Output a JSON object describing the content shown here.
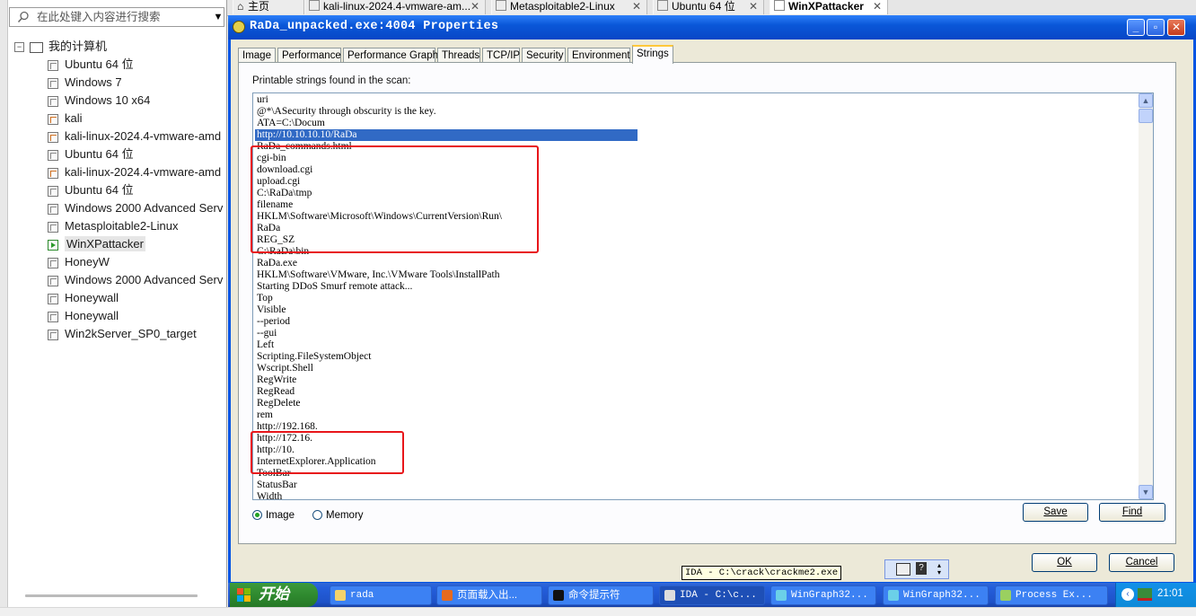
{
  "sidebar": {
    "search_placeholder": "在此处键入内容进行搜索",
    "root_label": "我的计算机",
    "items": [
      {
        "label": "Ubuntu 64 位",
        "icon": "vm-icon"
      },
      {
        "label": "Windows 7",
        "icon": "vm-icon"
      },
      {
        "label": "Windows 10 x64",
        "icon": "vm-icon"
      },
      {
        "label": "kali",
        "icon": "kali-vm-icon"
      },
      {
        "label": "kali-linux-2024.4-vmware-amd",
        "icon": "kali-vm-icon"
      },
      {
        "label": "Ubuntu 64 位",
        "icon": "vm-icon"
      },
      {
        "label": "kali-linux-2024.4-vmware-amd",
        "icon": "kali-vm-icon"
      },
      {
        "label": "Ubuntu 64 位",
        "icon": "vm-icon"
      },
      {
        "label": "Windows 2000 Advanced Serv",
        "icon": "vm-icon"
      },
      {
        "label": "Metasploitable2-Linux",
        "icon": "vm-icon"
      },
      {
        "label": "WinXPattacker",
        "icon": "running-vm-icon",
        "selected": true
      },
      {
        "label": "HoneyW",
        "icon": "vm-icon"
      },
      {
        "label": "Windows 2000 Advanced Serv",
        "icon": "vm-icon"
      },
      {
        "label": "Honeywall",
        "icon": "vm-icon"
      },
      {
        "label": "Honeywall",
        "icon": "vm-icon"
      },
      {
        "label": "Win2kServer_SP0_target",
        "icon": "vm-icon"
      }
    ]
  },
  "tabs": [
    {
      "label": "主页",
      "icon": "home-icon"
    },
    {
      "label": "kali-linux-2024.4-vmware-am...",
      "close": "✕"
    },
    {
      "label": "Metasploitable2-Linux",
      "close": "✕"
    },
    {
      "label": "Ubuntu 64 位",
      "close": "✕"
    },
    {
      "label": "WinXPattacker",
      "close": "✕",
      "active": true
    }
  ],
  "window": {
    "title": "RaDa_unpacked.exe:4004 Properties",
    "prop_tabs": [
      "Image",
      "Performance",
      "Performance Graph",
      "Threads",
      "TCP/IP",
      "Security",
      "Environment",
      "Strings"
    ],
    "active_tab": "Strings",
    "strings_label": "Printable strings found in the scan:",
    "strings": [
      "uri",
      "@*\\ASecurity through obscurity is the key.",
      "ATA=C:\\Docum",
      "http://10.10.10.10/RaDa",
      "RaDa_commands.html",
      "cgi-bin",
      "download.cgi",
      "upload.cgi",
      "C:\\RaDa\\tmp",
      "filename",
      "HKLM\\Software\\Microsoft\\Windows\\CurrentVersion\\Run\\",
      "RaDa",
      "REG_SZ",
      "C:\\RaDa\\bin",
      "RaDa.exe",
      "HKLM\\Software\\VMware, Inc.\\VMware Tools\\InstallPath",
      "Starting DDoS Smurf remote attack...",
      "Top",
      "Visible",
      "--period",
      "--gui",
      "Left",
      "Scripting.FileSystemObject",
      "Wscript.Shell",
      "RegWrite",
      "RegRead",
      "RegDelete",
      "rem",
      "http://192.168.",
      "http://172.16.",
      "http://10.",
      "InternetExplorer.Application",
      "ToolBar",
      "StatusBar",
      "Width"
    ],
    "selected_string_index": 3,
    "radio_image": "Image",
    "radio_memory": "Memory",
    "radio_selected": "Image",
    "save_label": "Save",
    "find_label": "Find",
    "ok_label": "OK",
    "cancel_label": "Cancel"
  },
  "taskbar": {
    "start_label": "开始",
    "tasks": [
      {
        "label": "rada",
        "icon": "folder-icon"
      },
      {
        "label": "页面载入出...",
        "icon": "firefox-icon"
      },
      {
        "label": "命令提示符",
        "icon": "cmd-icon"
      },
      {
        "label": "IDA - C:\\c...",
        "icon": "ida-icon",
        "active": true
      },
      {
        "label": "WinGraph32...",
        "icon": "wingraph-icon"
      },
      {
        "label": "WinGraph32...",
        "icon": "wingraph-icon"
      },
      {
        "label": "Process Ex...",
        "icon": "process-explorer-icon"
      }
    ],
    "clock": "21:01",
    "tooltip": "IDA - C:\\crack\\crackme2.exe"
  },
  "colors": {
    "xp_blue": "#0054e3",
    "selection": "#316ac5",
    "annotation_red": "#e8161a",
    "start_green": "#2f8a2f"
  }
}
